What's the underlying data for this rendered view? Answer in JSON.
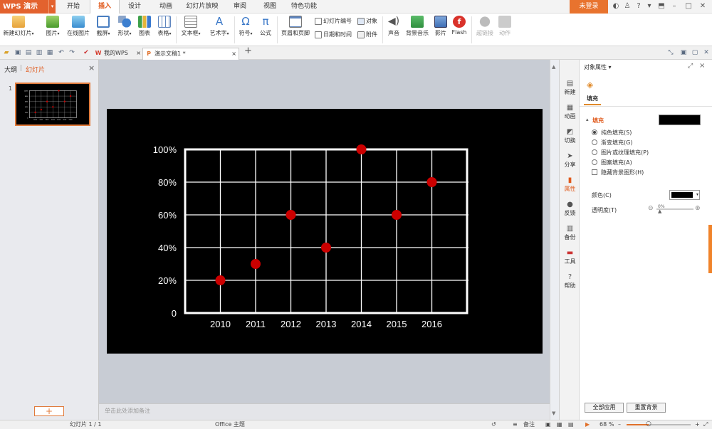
{
  "app": {
    "name": "WPS 演示",
    "menu_arrow": "▾"
  },
  "menu_tabs": [
    "开始",
    "插入",
    "设计",
    "动画",
    "幻灯片放映",
    "审阅",
    "视图",
    "特色功能"
  ],
  "login_label": "未登录",
  "ribbon": {
    "big_buttons": [
      {
        "label": "新建幻灯片",
        "icon": "new-slide-icon"
      },
      {
        "label": "图片",
        "icon": "picture-icon"
      },
      {
        "label": "在线图片",
        "icon": "online-picture-icon"
      },
      {
        "label": "截屏",
        "icon": "screenshot-icon"
      },
      {
        "label": "形状",
        "icon": "shape-icon"
      },
      {
        "label": "图表",
        "icon": "chart-icon"
      },
      {
        "label": "表格",
        "icon": "table-icon"
      },
      {
        "label": "文本框",
        "icon": "textbox-icon"
      },
      {
        "label": "艺术字",
        "icon": "wordart-icon"
      },
      {
        "label": "符号",
        "icon": "symbol-icon",
        "glyph": "Ω"
      },
      {
        "label": "公式",
        "icon": "formula-icon",
        "glyph": "π"
      },
      {
        "label": "页眉和页脚",
        "icon": "header-footer-icon"
      },
      {
        "label": "声音",
        "icon": "sound-icon"
      },
      {
        "label": "背景音乐",
        "icon": "background-music-icon"
      },
      {
        "label": "影片",
        "icon": "movie-icon"
      },
      {
        "label": "Flash",
        "icon": "flash-icon"
      },
      {
        "label": "超链接",
        "icon": "hyperlink-icon"
      },
      {
        "label": "动作",
        "icon": "action-icon"
      }
    ],
    "small_buttons": [
      {
        "label": "幻灯片编号",
        "icon": "slide-number-icon"
      },
      {
        "label": "日期和时间",
        "icon": "date-time-icon"
      },
      {
        "label": "对象",
        "icon": "object-icon"
      },
      {
        "label": "附件",
        "icon": "attachment-icon"
      }
    ]
  },
  "doc_tabs": [
    {
      "label": "我的WPS",
      "icon": "wps-logo-icon",
      "close": "×"
    },
    {
      "label": "演示文稿1 *",
      "icon": "presentation-icon",
      "close": "×"
    }
  ],
  "new_tab_glyph": "+",
  "left_pane": {
    "tab_outline": "大纲",
    "tab_slides": "幻灯片",
    "slide_number": "1",
    "add_slide_glyph": "+",
    "close": "×"
  },
  "notes_placeholder": "单击此处添加备注",
  "status": {
    "slide_info": "幻灯片 1 / 1",
    "theme": "Office 主题",
    "notes_label": "备注",
    "zoom": "68 %"
  },
  "right_strip": [
    "新建",
    "动画",
    "切换",
    "分享",
    "属性",
    "反馈",
    "备份",
    "工具",
    "帮助"
  ],
  "properties": {
    "title": "对象属性 ▾",
    "tab_fill": "填充",
    "section_fill": "填充",
    "fill_color": "#000000",
    "options": [
      {
        "label": "纯色填充(S)",
        "type": "radio",
        "selected": true
      },
      {
        "label": "渐变填充(G)",
        "type": "radio",
        "selected": false
      },
      {
        "label": "图片或纹理填充(P)",
        "type": "radio",
        "selected": false
      },
      {
        "label": "图案填充(A)",
        "type": "radio",
        "selected": false
      },
      {
        "label": "隐藏背景图形(H)",
        "type": "checkbox",
        "selected": false
      }
    ],
    "color_label": "颜色(C)",
    "transparency_label": "透明度(T)",
    "transparency_value": "0%",
    "apply_all_label": "全部应用",
    "reset_label": "重置背景"
  },
  "chart_data": {
    "type": "scatter",
    "categories": [
      "2010",
      "2011",
      "2012",
      "2013",
      "2014",
      "2015",
      "2016"
    ],
    "x": [
      "2010",
      "2011",
      "2012",
      "2013",
      "2014",
      "2015",
      "2016"
    ],
    "series": [
      {
        "values": [
          20,
          30,
          60,
          40,
          100,
          60,
          80
        ]
      }
    ],
    "ytick_labels": [
      "0",
      "20%",
      "40%",
      "60%",
      "80%",
      "100%"
    ],
    "yticks": [
      0,
      20,
      40,
      60,
      80,
      100
    ],
    "ylim": [
      0,
      100
    ],
    "grid": true,
    "colors": {
      "background": "#000000",
      "grid": "#ffffff",
      "marker": "#cc0000",
      "text": "#ffffff"
    }
  }
}
